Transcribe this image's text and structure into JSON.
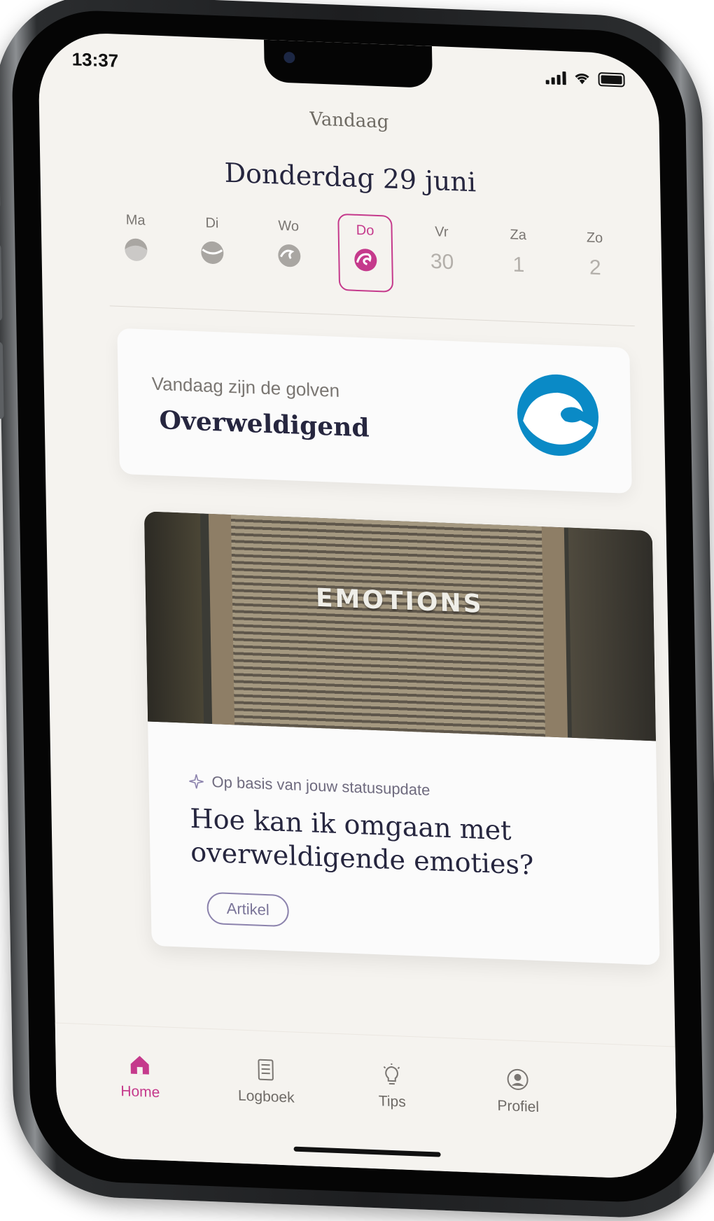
{
  "status_bar": {
    "time": "13:37"
  },
  "header": {
    "title": "Vandaag",
    "date": "Donderdag 29 juni"
  },
  "week": {
    "days": [
      {
        "label": "Ma",
        "icon": "wave-icon-gray"
      },
      {
        "label": "Di",
        "icon": "wave-icon-gray"
      },
      {
        "label": "Wo",
        "icon": "wave-icon-gray"
      },
      {
        "label": "Do",
        "icon": "wave-icon-pink",
        "selected": true
      },
      {
        "label": "Vr",
        "num": "30"
      },
      {
        "label": "Za",
        "num": "1"
      },
      {
        "label": "Zo",
        "num": "2"
      }
    ]
  },
  "mood": {
    "subtitle": "Vandaag zijn de golven",
    "value": "Overweldigend",
    "logo_color": "#0a8ac6"
  },
  "article": {
    "image_word": "EMOTIONS",
    "tag": "Op basis van jouw statusupdate",
    "title": "Hoe kan ik omgaan met overweldigende emoties?",
    "button": "Artikel"
  },
  "tabs": [
    {
      "label": "Home",
      "icon": "home-icon",
      "active": true
    },
    {
      "label": "Logboek",
      "icon": "notebook-icon"
    },
    {
      "label": "Tips",
      "icon": "lightbulb-icon"
    },
    {
      "label": "Profiel",
      "icon": "profile-icon"
    }
  ],
  "colors": {
    "accent": "#c53a8c",
    "background": "#f5f3ef",
    "text_dark": "#26263f"
  }
}
